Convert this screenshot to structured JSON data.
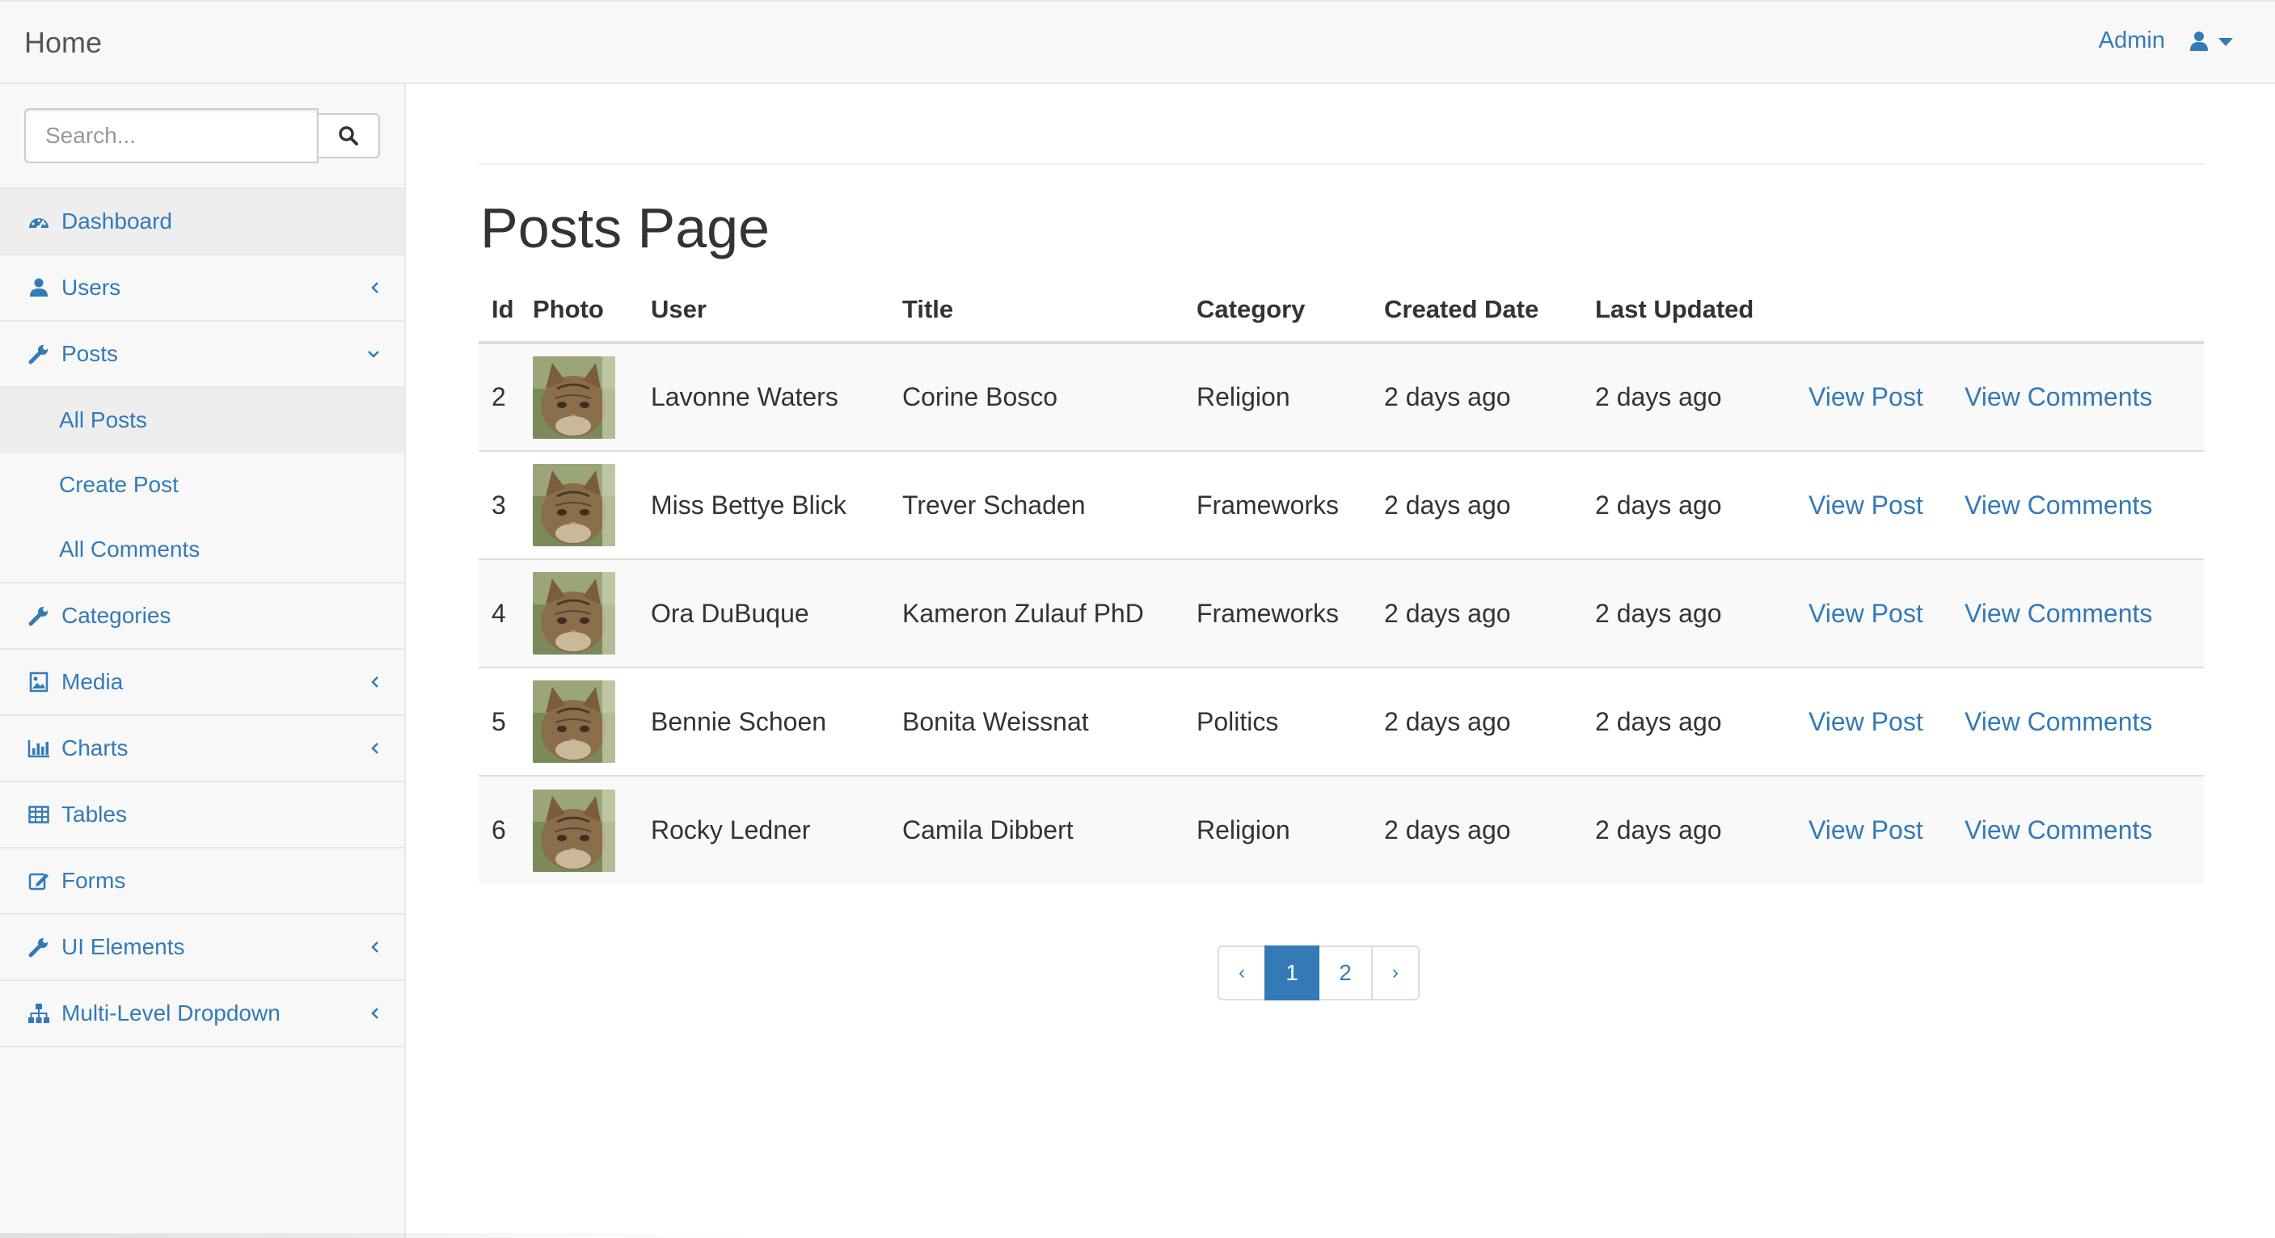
{
  "navbar": {
    "brand": "Home",
    "user_name": "Admin"
  },
  "sidebar": {
    "search_placeholder": "Search...",
    "items": [
      {
        "label": "Dashboard",
        "icon": "dashboard-icon",
        "has_arrow": false
      },
      {
        "label": "Users",
        "icon": "user-icon",
        "has_arrow": true
      },
      {
        "label": "Posts",
        "icon": "wrench-icon",
        "has_arrow": true,
        "expanded": true,
        "children": [
          {
            "label": "All Posts",
            "active": true
          },
          {
            "label": "Create Post"
          },
          {
            "label": "All Comments"
          }
        ]
      },
      {
        "label": "Categories",
        "icon": "wrench-icon",
        "has_arrow": false
      },
      {
        "label": "Media",
        "icon": "image-icon",
        "has_arrow": true
      },
      {
        "label": "Charts",
        "icon": "bar-chart-icon",
        "has_arrow": true
      },
      {
        "label": "Tables",
        "icon": "table-icon",
        "has_arrow": false
      },
      {
        "label": "Forms",
        "icon": "edit-icon",
        "has_arrow": false
      },
      {
        "label": "UI Elements",
        "icon": "wrench-icon",
        "has_arrow": true
      },
      {
        "label": "Multi-Level Dropdown",
        "icon": "sitemap-icon",
        "has_arrow": true
      }
    ]
  },
  "main": {
    "title": "Posts Page",
    "columns": [
      "Id",
      "Photo",
      "User",
      "Title",
      "Category",
      "Created Date",
      "Last Updated"
    ],
    "rows": [
      {
        "id": "2",
        "user": "Lavonne Waters",
        "title": "Corine Bosco",
        "category": "Religion",
        "created": "2 days ago",
        "updated": "2 days ago",
        "view_post": "View Post",
        "view_comments": "View Comments"
      },
      {
        "id": "3",
        "user": "Miss Bettye Blick",
        "title": "Trever Schaden",
        "category": "Frameworks",
        "created": "2 days ago",
        "updated": "2 days ago",
        "view_post": "View Post",
        "view_comments": "View Comments"
      },
      {
        "id": "4",
        "user": "Ora DuBuque",
        "title": "Kameron Zulauf PhD",
        "category": "Frameworks",
        "created": "2 days ago",
        "updated": "2 days ago",
        "view_post": "View Post",
        "view_comments": "View Comments"
      },
      {
        "id": "5",
        "user": "Bennie Schoen",
        "title": "Bonita Weissnat",
        "category": "Politics",
        "created": "2 days ago",
        "updated": "2 days ago",
        "view_post": "View Post",
        "view_comments": "View Comments"
      },
      {
        "id": "6",
        "user": "Rocky Ledner",
        "title": "Camila Dibbert",
        "category": "Religion",
        "created": "2 days ago",
        "updated": "2 days ago",
        "view_post": "View Post",
        "view_comments": "View Comments"
      }
    ],
    "pagination": {
      "prev": "‹",
      "pages": [
        "1",
        "2"
      ],
      "active_page": "1",
      "next": "›"
    }
  },
  "colors": {
    "link": "#337ab7",
    "navbar_bg": "#f8f8f8",
    "border": "#e7e7e7",
    "active_page_bg": "#337ab7"
  }
}
